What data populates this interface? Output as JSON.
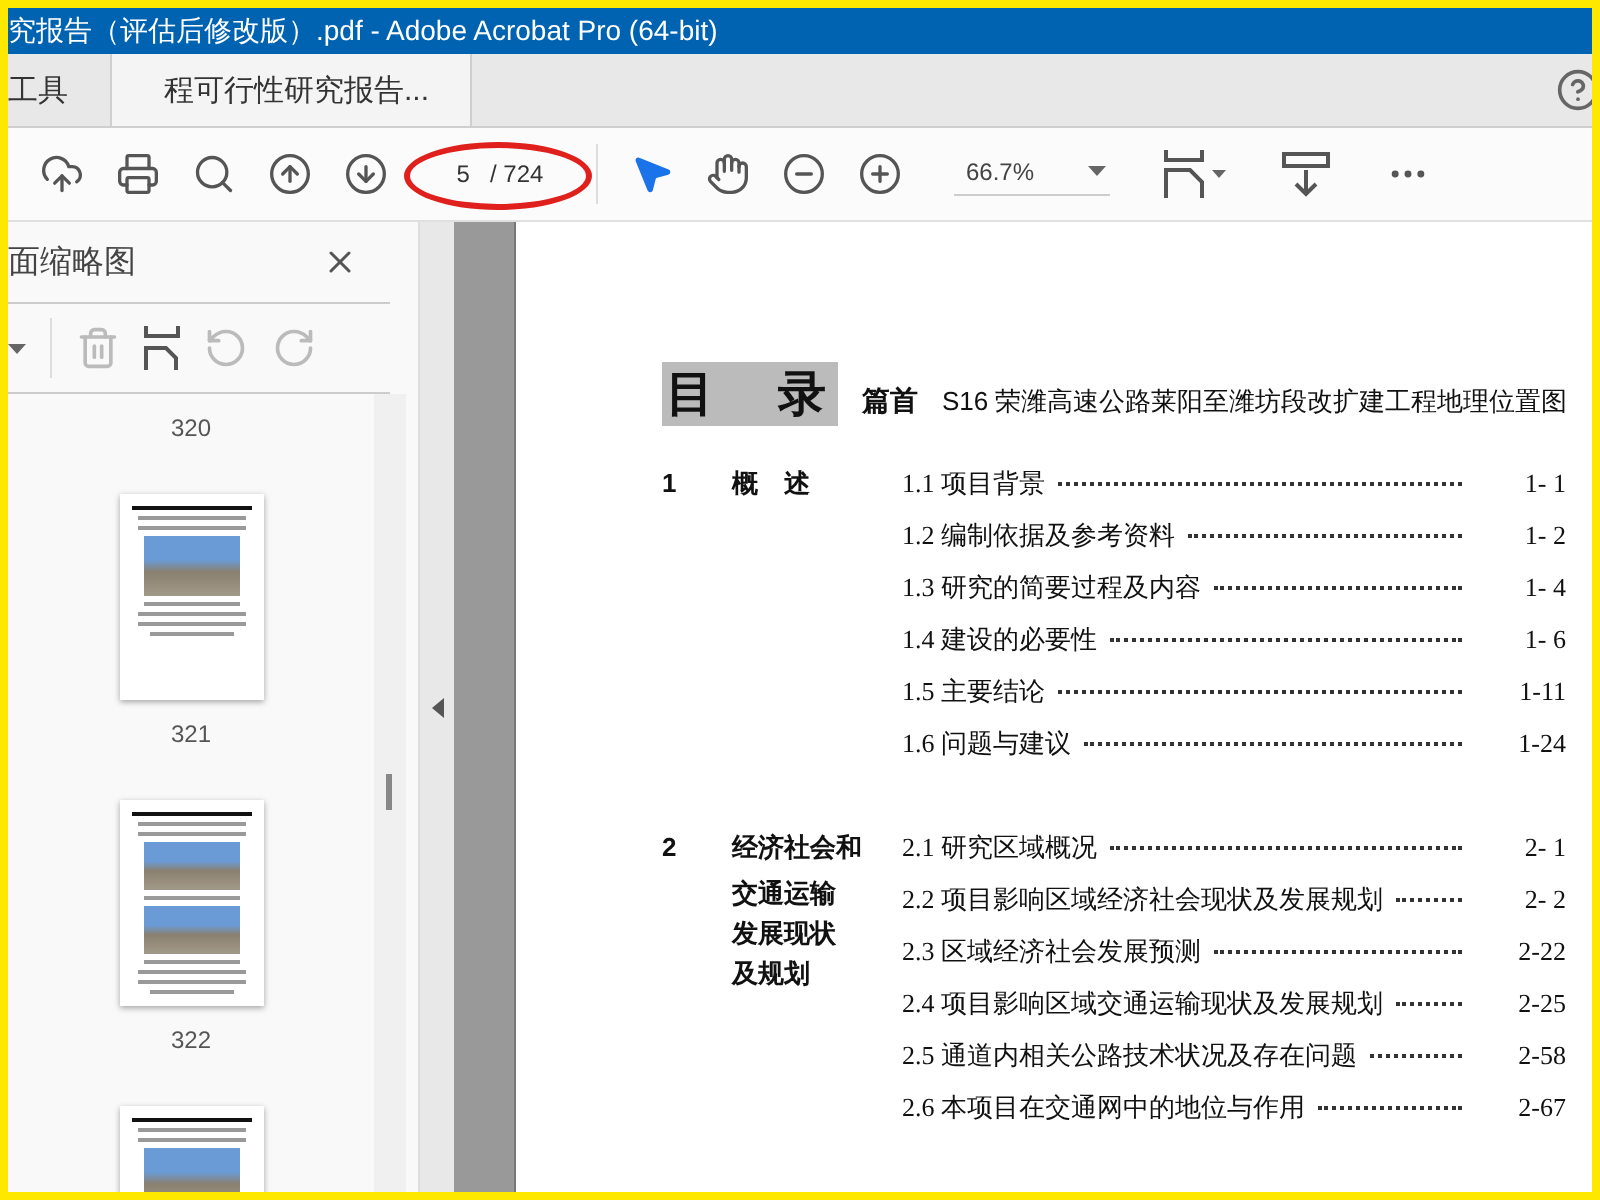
{
  "window": {
    "title": "究报告（评估后修改版）.pdf - Adobe Acrobat Pro (64-bit)"
  },
  "tabs": [
    {
      "label": "工具",
      "selected": false
    },
    {
      "label": "程可行性研究报告...",
      "selected": true
    }
  ],
  "toolbar": {
    "page_number": "5",
    "page_total": "/ 724",
    "zoom": "66.7%"
  },
  "sidebar": {
    "title": "面缩略图",
    "thumbnails": [
      {
        "kind": "label",
        "label": "320"
      },
      {
        "kind": "page",
        "label": "321"
      },
      {
        "kind": "two-photo-page",
        "label": "322"
      },
      {
        "kind": "page"
      }
    ]
  },
  "document": {
    "heading": "目　录",
    "preface_label": "篇首",
    "preface_title": "S16 荣潍高速公路莱阳至潍坊段改扩建工程地理位置图",
    "sections": [
      {
        "number": "1",
        "title_lines": [
          "概　述"
        ],
        "entries": [
          {
            "title": "1.1 项目背景",
            "page": "1- 1"
          },
          {
            "title": "1.2 编制依据及参考资料",
            "page": "1- 2"
          },
          {
            "title": "1.3 研究的简要过程及内容",
            "page": "1- 4"
          },
          {
            "title": "1.4 建设的必要性",
            "page": "1- 6"
          },
          {
            "title": "1.5 主要结论",
            "page": "1-11"
          },
          {
            "title": "1.6 问题与建议",
            "page": "1-24"
          }
        ]
      },
      {
        "number": "2",
        "title_lines": [
          "经济社会和",
          "交通运输",
          "发展现状",
          "及规划"
        ],
        "entries": [
          {
            "title": "2.1 研究区域概况",
            "page": "2- 1"
          },
          {
            "title": "2.2 项目影响区域经济社会现状及发展规划",
            "page": "2- 2"
          },
          {
            "title": "2.3 区域经济社会发展预测",
            "page": "2-22"
          },
          {
            "title": "2.4 项目影响区域交通运输现状及发展规划",
            "page": "2-25"
          },
          {
            "title": "2.5 通道内相关公路技术状况及存在问题",
            "page": "2-58"
          },
          {
            "title": "2.6 本项目在交通网中的地位与作用",
            "page": "2-67"
          }
        ]
      }
    ]
  }
}
